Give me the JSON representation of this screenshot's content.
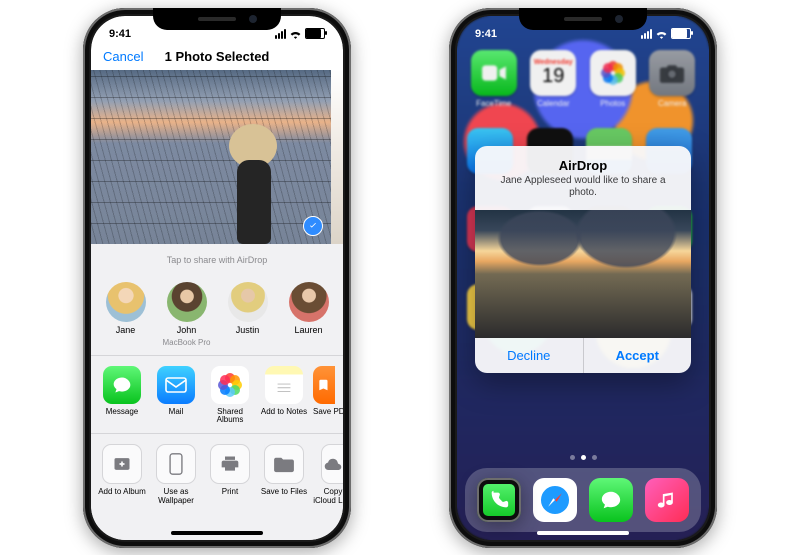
{
  "status": {
    "time": "9:41"
  },
  "left": {
    "cancel": "Cancel",
    "title": "1 Photo Selected",
    "airdrop_hint": "Tap to share with AirDrop",
    "contacts": [
      {
        "name": "Jane",
        "sub": ""
      },
      {
        "name": "John",
        "sub": "MacBook Pro"
      },
      {
        "name": "Justin",
        "sub": ""
      },
      {
        "name": "Lauren",
        "sub": ""
      }
    ],
    "apps": [
      {
        "label": "Message"
      },
      {
        "label": "Mail"
      },
      {
        "label": "Shared Albums"
      },
      {
        "label": "Add to Notes"
      },
      {
        "label": "Save PDF to Books"
      }
    ],
    "actions": [
      {
        "label": "Add to Album"
      },
      {
        "label": "Use as Wallpaper"
      },
      {
        "label": "Print"
      },
      {
        "label": "Save to Files"
      },
      {
        "label": "Copy iCloud Link"
      }
    ]
  },
  "right": {
    "home": {
      "row1": [
        "FaceTime",
        "Calendar",
        "Photos",
        "Camera"
      ],
      "calendar": {
        "dow": "Wednesday",
        "day": "19"
      }
    },
    "modal": {
      "title": "AirDrop",
      "subtitle": "Jane Appleseed would like to share a photo.",
      "decline": "Decline",
      "accept": "Accept"
    }
  }
}
